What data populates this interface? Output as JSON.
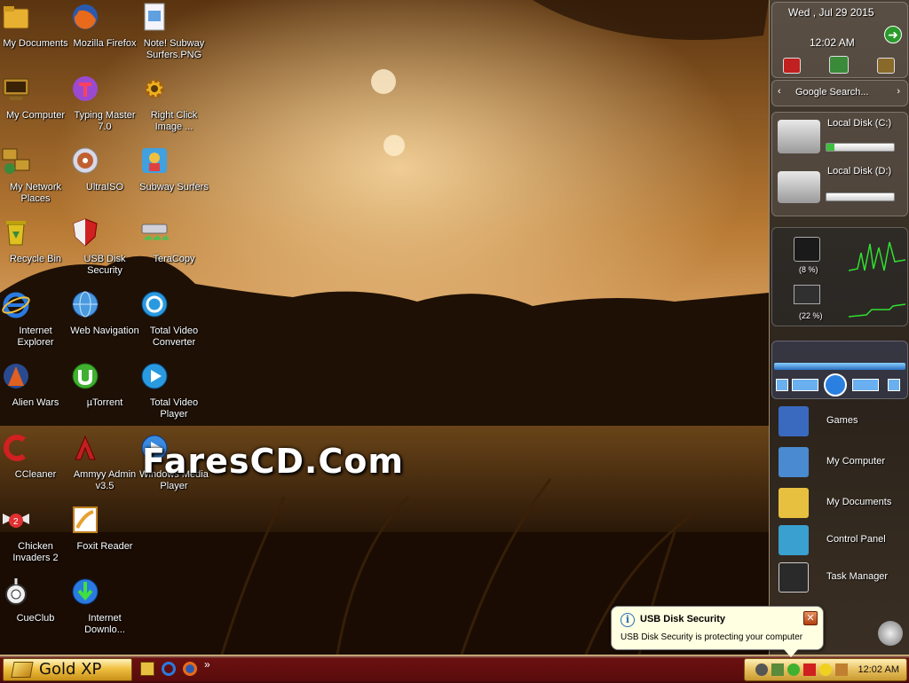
{
  "desktop_icons": [
    {
      "name": "My Documents",
      "icon": "folder-docs-icon",
      "color": "#e8b030"
    },
    {
      "name": "Mozilla Firefox",
      "icon": "firefox-icon",
      "color": "#e86a1a"
    },
    {
      "name": "Note! Subway Surfers.PNG",
      "icon": "image-file-icon",
      "color": "#e0e0f0"
    },
    {
      "name": "My Computer",
      "icon": "computer-icon",
      "color": "#b88a2a"
    },
    {
      "name": "Typing Master 7.0",
      "icon": "typing-master-icon",
      "color": "#9a4ad0"
    },
    {
      "name": "Right Click Image ...",
      "icon": "gear-star-icon",
      "color": "#f0b020"
    },
    {
      "name": "My Network Places",
      "icon": "network-icon",
      "color": "#c89a30"
    },
    {
      "name": "UltraISO",
      "icon": "disc-icon",
      "color": "#c0c0d0"
    },
    {
      "name": "Subway Surfers",
      "icon": "game-icon",
      "color": "#40a0e0"
    },
    {
      "name": "Recycle Bin",
      "icon": "recycle-bin-icon",
      "color": "#e0c020"
    },
    {
      "name": "USB Disk Security",
      "icon": "shield-icon",
      "color": "#d02020"
    },
    {
      "name": "TeraCopy",
      "icon": "teracopy-icon",
      "color": "#50c050"
    },
    {
      "name": "Internet Explorer",
      "icon": "ie-icon",
      "color": "#2a7ae0"
    },
    {
      "name": "Web Navigation",
      "icon": "globe-icon",
      "color": "#4a9ae0"
    },
    {
      "name": "Total Video Converter",
      "icon": "video-converter-icon",
      "color": "#2a9ae0"
    },
    {
      "name": "Alien Wars",
      "icon": "alien-wars-icon",
      "color": "#e06020"
    },
    {
      "name": "µTorrent",
      "icon": "utorrent-icon",
      "color": "#40b030"
    },
    {
      "name": "Total Video Player",
      "icon": "video-player-icon",
      "color": "#2a9ae0"
    },
    {
      "name": "CCleaner",
      "icon": "ccleaner-icon",
      "color": "#d02020"
    },
    {
      "name": "Ammyy Admin v3.5",
      "icon": "ammyy-icon",
      "color": "#c02020"
    },
    {
      "name": "Windows Media Player",
      "icon": "media-player-icon",
      "color": "#3a8ae0"
    },
    {
      "name": "Chicken Invaders 2",
      "icon": "chicken-icon",
      "color": "#e03030"
    },
    {
      "name": "Foxit Reader",
      "icon": "pdf-icon",
      "color": "#e8a030"
    },
    {
      "name": "CueClub",
      "icon": "cueclub-icon",
      "color": "#d0d0d0"
    },
    {
      "name": "Internet Downlo...",
      "icon": "download-manager-icon",
      "color": "#40a040"
    }
  ],
  "watermark": "FaresCD.Com",
  "sidebar": {
    "date": "Wed , Jul 29 2015",
    "time": "12:02 AM",
    "search_placeholder": "Google Search...",
    "disks": [
      {
        "label": "Local Disk (C:)",
        "used_fraction": 0.12
      },
      {
        "label": "Local Disk (D:)",
        "used_fraction": 0.0
      }
    ],
    "cpu_percent": "(8 %)",
    "ram_percent": "(22 %)",
    "launchers": [
      "Games",
      "My Computer",
      "My Documents",
      "Control Panel",
      "Task Manager"
    ]
  },
  "taskbar": {
    "start_label": "Gold XP",
    "overflow": "»",
    "clock": "12:02 AM"
  },
  "balloon": {
    "title": "USB Disk Security",
    "message": "USB Disk Security is protecting your computer"
  }
}
